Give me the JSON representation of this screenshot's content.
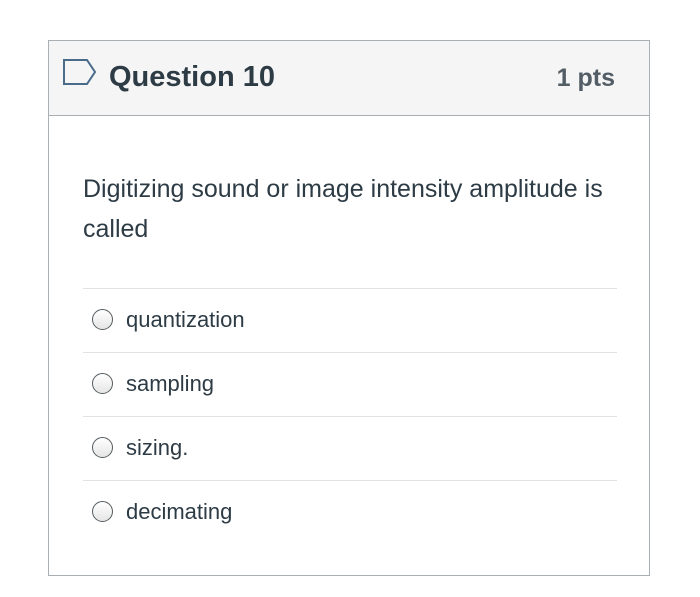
{
  "question": {
    "title": "Question 10",
    "points": "1 pts",
    "text": "Digitizing sound or image intensity amplitude is called",
    "flag_icon": "bookmark-flag-icon",
    "answers": [
      {
        "label": "quantization",
        "selected": false
      },
      {
        "label": "sampling",
        "selected": false
      },
      {
        "label": "sizing.",
        "selected": false
      },
      {
        "label": "decimating",
        "selected": false
      }
    ]
  },
  "colors": {
    "header_bg": "#f5f5f5",
    "border": "#a9afb3",
    "text": "#2d3b45",
    "flag": "#4a6b8a",
    "divider": "#dfe3e5"
  }
}
